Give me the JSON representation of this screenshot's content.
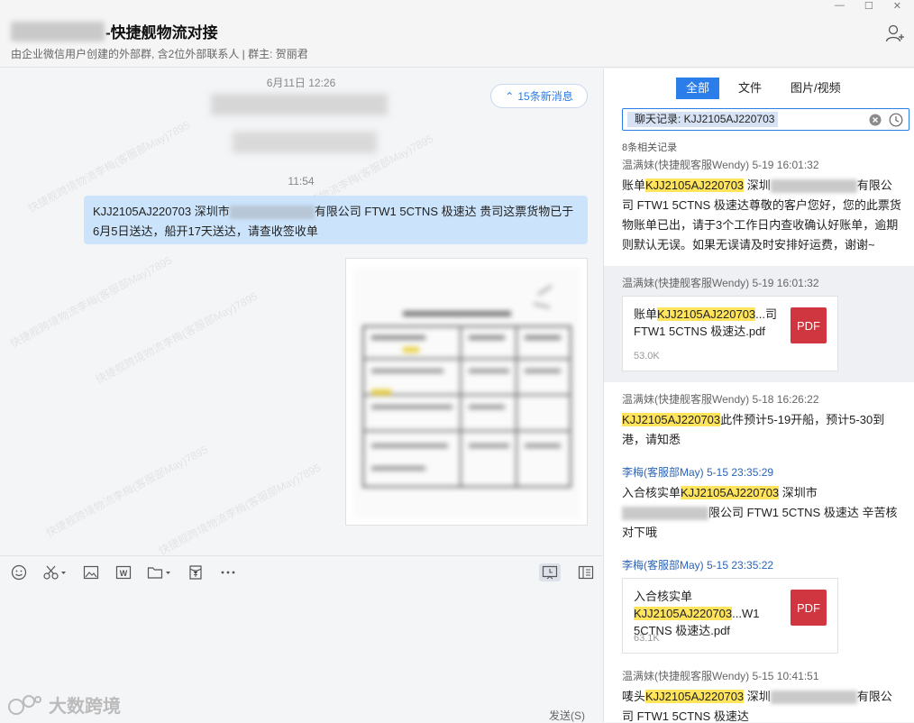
{
  "window": {
    "title": "-快捷舰物流对接",
    "subtitle": "由企业微信用户创建的外部群, 含2位外部联系人 | 群主: 贺丽君",
    "controls": [
      "—",
      "☐",
      "✕"
    ]
  },
  "chat": {
    "time1": "6月11日 12:26",
    "time2": "11:54",
    "new_messages": "15条新消息",
    "bubble": {
      "part1": "KJJ2105AJ220703 深圳市",
      "part2": "有限公司 FTW1 5CTNS 极速达  贵司这票货物已于6月5日送达，船开17天送达，请查收签收单"
    },
    "watermark": "快捷舰跨境物流李梅(客服部May)7895"
  },
  "toolbar": {
    "send": "发送(S)",
    "brand": "大数跨境"
  },
  "search": {
    "tabs": [
      "全部",
      "文件",
      "图片/视频"
    ],
    "query": "聊天记录: KJJ2105AJ220703",
    "count": "8条相关记录",
    "results": [
      {
        "sender": "温满妹(快捷舰客服Wendy) 5-19 16:01:32",
        "before": "账单",
        "hl": "KJJ2105AJ220703",
        "mid": " 深圳",
        "after": "有限公司 FTW1 5CTNS 极速达尊敬的客户您好，您的此票货物账单已出，请于3个工作日内查收确认好账单，逾期则默认无误。如果无误请及时安排好运费，谢谢~"
      },
      {
        "sender": "温满妹(快捷舰客服Wendy) 5-19 16:01:32",
        "file_before": "账单",
        "file_hl": "KJJ2105AJ220703",
        "file_after": "...司 FTW1 5CTNS 极速达.pdf",
        "size": "53.0K",
        "badge": "PDF"
      },
      {
        "sender": "温满妹(快捷舰客服Wendy) 5-18 16:26:22",
        "hl": "KJJ2105AJ220703",
        "after": "此件预计5-19开船，预计5-30到港，请知悉"
      },
      {
        "sender": "李梅(客服部May) 5-15 23:35:29",
        "before": "入合核实单",
        "hl": "KJJ2105AJ220703",
        "mid": " 深圳市",
        "after": "限公司 FTW1 5CTNS 极速达 辛苦核对下哦"
      },
      {
        "sender": "李梅(客服部May) 5-15 23:35:22",
        "file_before": "入合核实单",
        "file_hl": "KJJ2105AJ220703",
        "file_after": "...W1 5CTNS 极速达.pdf",
        "size": "63.1K",
        "badge": "PDF"
      },
      {
        "sender": "温满妹(快捷舰客服Wendy) 5-15 10:41:51",
        "before": "唛头",
        "hl": "KJJ2105AJ220703",
        "mid": " 深圳",
        "after": "有限公司 FTW1 5CTNS 极速达"
      }
    ]
  },
  "colors": {
    "accent": "#2b7de9",
    "highlight": "#ffe45c",
    "bubble": "#cce4fb",
    "pdf": "#d0363f"
  }
}
